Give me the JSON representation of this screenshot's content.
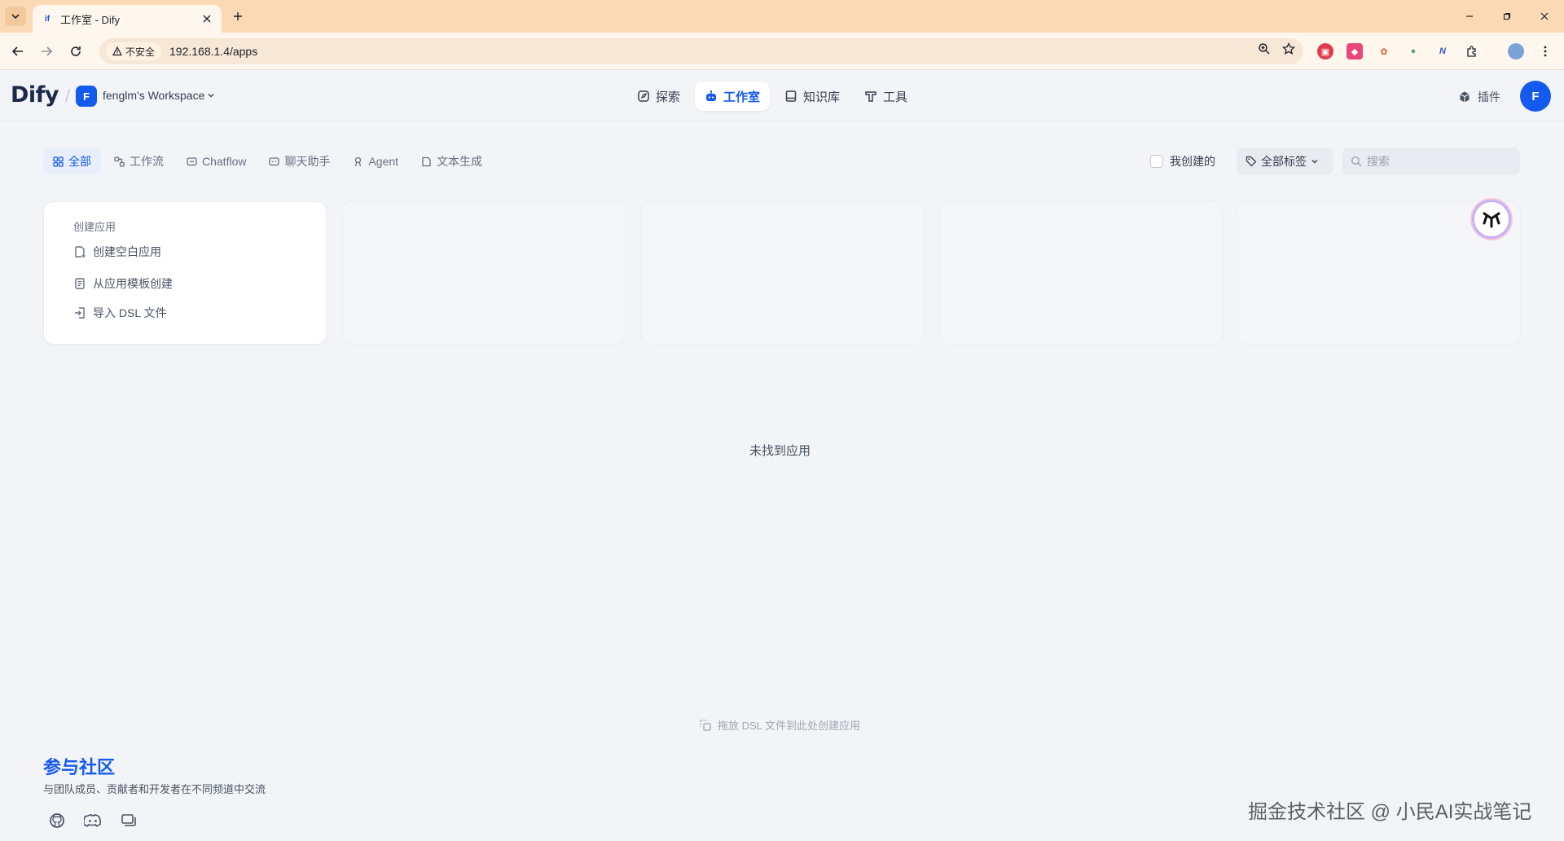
{
  "browser": {
    "tab_title": "工作室 - Dify",
    "tab_favicon": "dify-favicon",
    "security_label": "不安全",
    "url": "192.168.1.4/apps"
  },
  "header": {
    "logo": "Dify",
    "workspace_initial": "F",
    "workspace_name": "fenglm's Workspace",
    "nav": [
      {
        "label": "探索",
        "icon": "compass-icon"
      },
      {
        "label": "工作室",
        "icon": "robot-icon"
      },
      {
        "label": "知识库",
        "icon": "book-icon"
      },
      {
        "label": "工具",
        "icon": "hammer-icon"
      }
    ],
    "plugins_label": "插件",
    "user_initial": "F"
  },
  "filters": {
    "tabs": [
      "全部",
      "工作流",
      "Chatflow",
      "聊天助手",
      "Agent",
      "文本生成"
    ],
    "active_tab": "全部",
    "created_by_me": "我创建的",
    "all_tags": "全部标签",
    "search_placeholder": "搜索"
  },
  "create_card": {
    "title": "创建应用",
    "items": [
      "创建空白应用",
      "从应用模板创建",
      "导入 DSL 文件"
    ]
  },
  "empty_message": "未找到应用",
  "drop_hint": "拖放 DSL 文件到此处创建应用",
  "community": {
    "title": "参与社区",
    "subtitle": "与团队成员、贡献者和开发者在不同频道中交流"
  },
  "watermark": "掘金技术社区 @ 小民AI实战笔记",
  "colors": {
    "accent": "#155aef",
    "tabbar": "#fbd9b5",
    "background": "#f2f4f7"
  }
}
